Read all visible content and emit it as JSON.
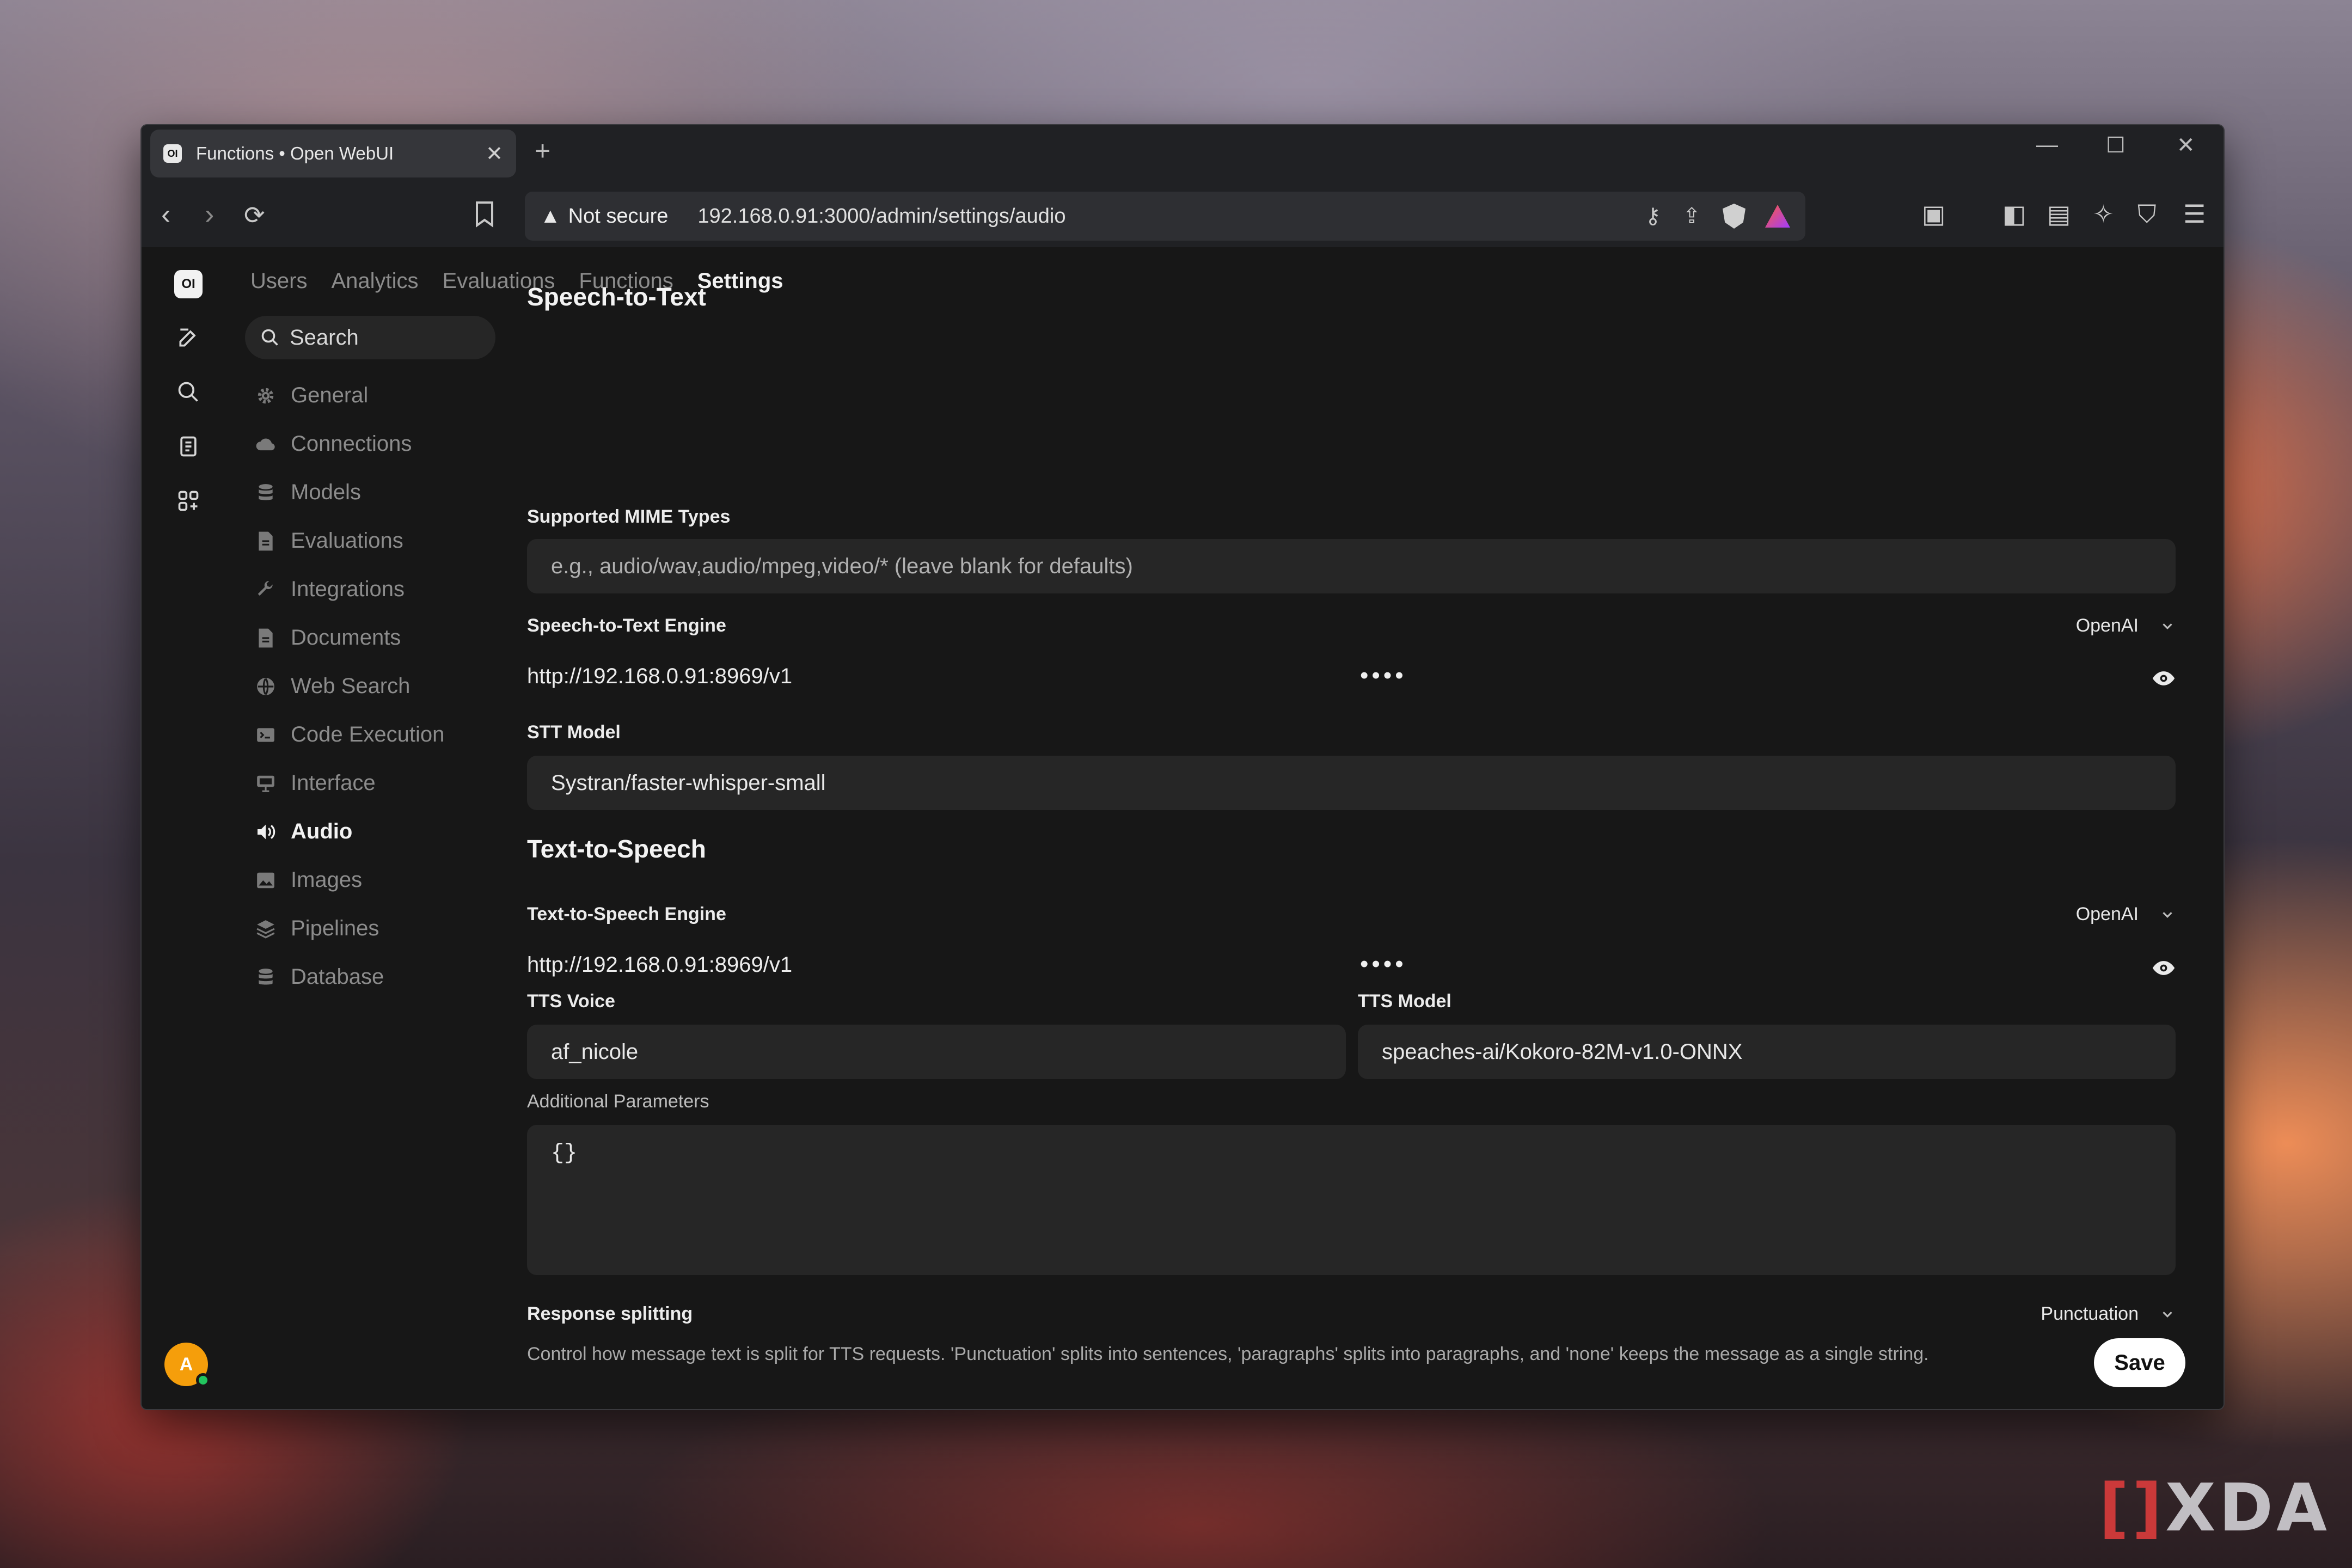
{
  "browser": {
    "tab_title": "Functions • Open WebUI",
    "tab_favicon": "OI",
    "new_tab": "+",
    "security_label": "Not secure",
    "url": "192.168.0.91:3000/admin/settings/audio"
  },
  "app": {
    "logo": "OI",
    "user_initial": "A",
    "nav_tabs": [
      {
        "label": "Users"
      },
      {
        "label": "Analytics"
      },
      {
        "label": "Evaluations"
      },
      {
        "label": "Functions"
      },
      {
        "label": "Settings",
        "active": true
      }
    ],
    "search_label": "Search",
    "sidebar": [
      {
        "label": "General",
        "icon": "gear-icon"
      },
      {
        "label": "Connections",
        "icon": "cloud-icon"
      },
      {
        "label": "Models",
        "icon": "database-icon"
      },
      {
        "label": "Evaluations",
        "icon": "document-icon"
      },
      {
        "label": "Integrations",
        "icon": "wrench-icon"
      },
      {
        "label": "Documents",
        "icon": "document-icon"
      },
      {
        "label": "Web Search",
        "icon": "globe-icon"
      },
      {
        "label": "Code Execution",
        "icon": "terminal-icon"
      },
      {
        "label": "Interface",
        "icon": "monitor-icon"
      },
      {
        "label": "Audio",
        "icon": "speaker-icon",
        "active": true
      },
      {
        "label": "Images",
        "icon": "image-icon"
      },
      {
        "label": "Pipelines",
        "icon": "layers-icon"
      },
      {
        "label": "Database",
        "icon": "database-icon"
      }
    ]
  },
  "stt": {
    "heading": "Speech-to-Text",
    "mime_label": "Supported MIME Types",
    "mime_placeholder": "e.g., audio/wav,audio/mpeg,video/* (leave blank for defaults)",
    "engine_label": "Speech-to-Text Engine",
    "engine_value": "OpenAI",
    "api_url": "http://192.168.0.91:8969/v1",
    "api_key_masked": "••••",
    "model_label": "STT Model",
    "model_value": "Systran/faster-whisper-small"
  },
  "tts": {
    "heading": "Text-to-Speech",
    "engine_label": "Text-to-Speech Engine",
    "engine_value": "OpenAI",
    "api_url": "http://192.168.0.91:8969/v1",
    "api_key_masked": "••••",
    "voice_label": "TTS Voice",
    "voice_value": "af_nicole",
    "model_label": "TTS Model",
    "model_value": "speaches-ai/Kokoro-82M-v1.0-ONNX",
    "params_label": "Additional Parameters",
    "params_value": "{}",
    "split_label": "Response splitting",
    "split_value": "Punctuation",
    "split_desc": "Control how message text is split for TTS requests. 'Punctuation' splits into sentences, 'paragraphs' splits into paragraphs, and 'none' keeps the message as a single string."
  },
  "save_label": "Save",
  "watermark": "XDA"
}
